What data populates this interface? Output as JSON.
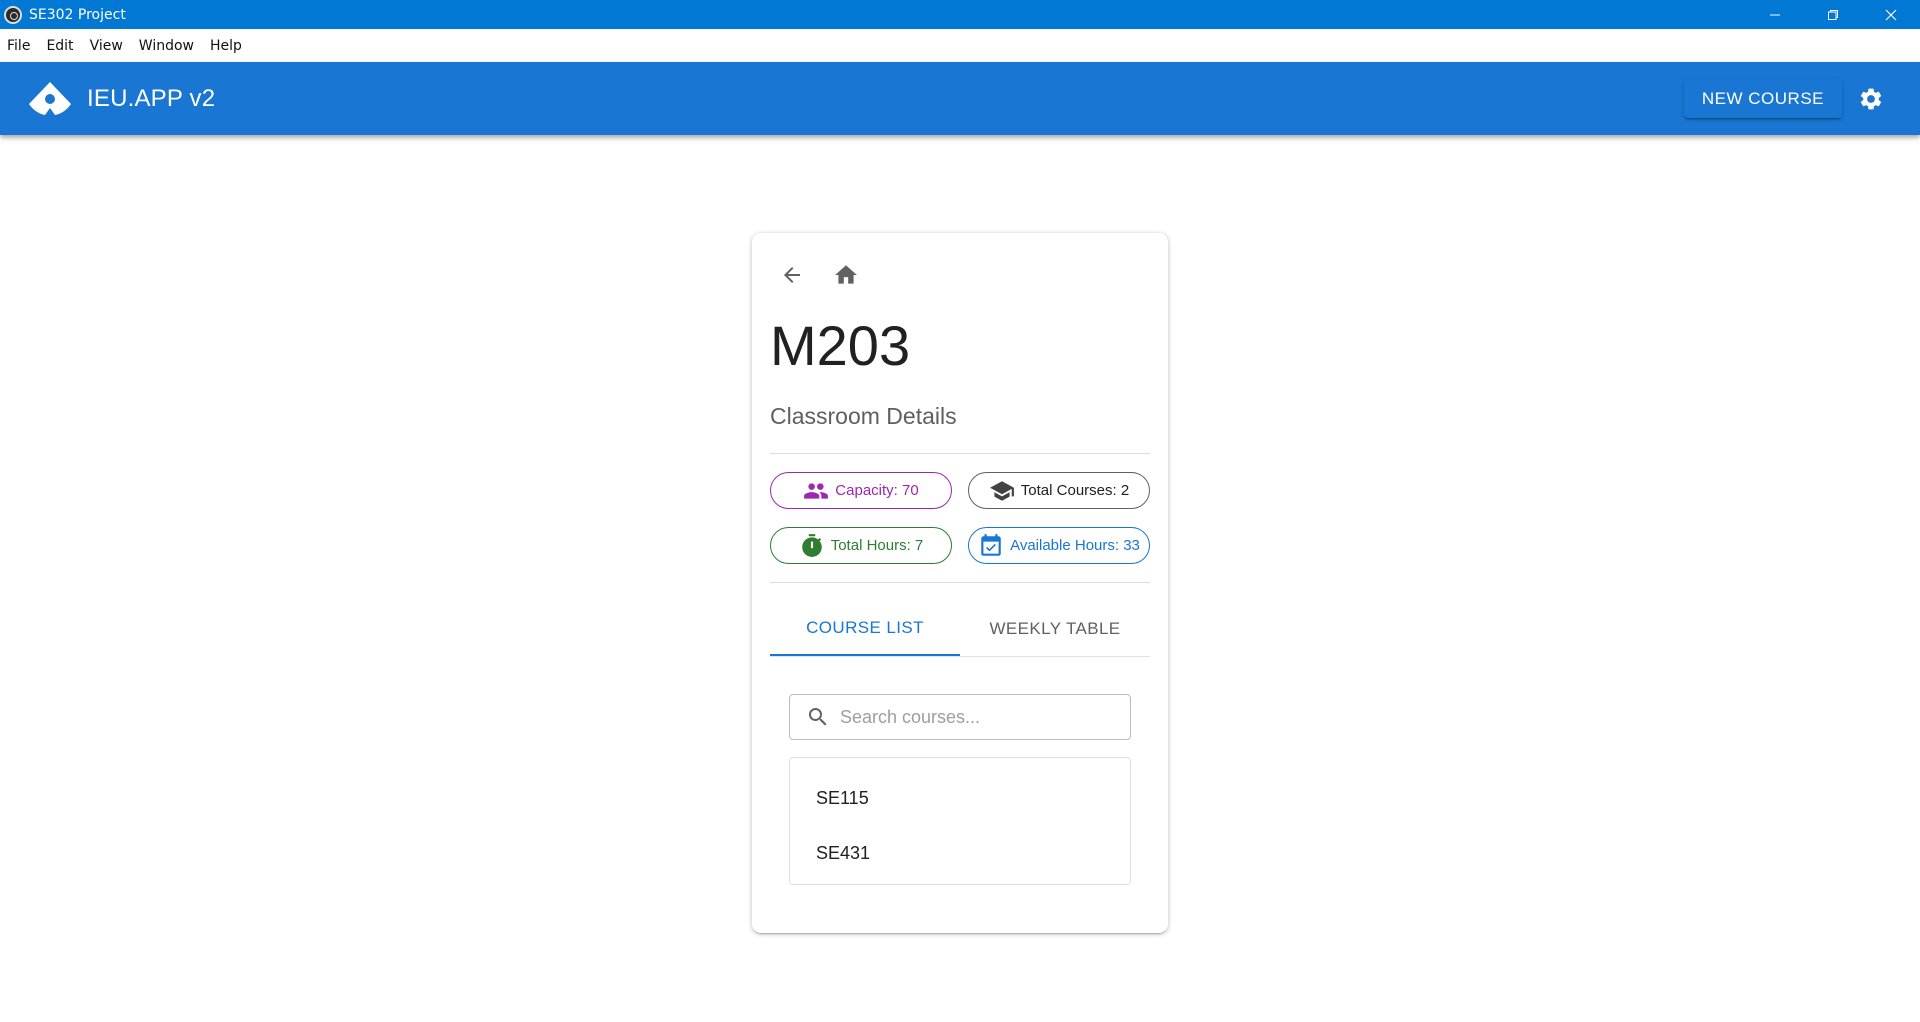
{
  "window": {
    "title": "SE302 Project",
    "menu": [
      "File",
      "Edit",
      "View",
      "Window",
      "Help"
    ]
  },
  "appbar": {
    "app_name": "IEU.APP v2",
    "new_course_label": "NEW COURSE",
    "logo_icon": "ieu-logo-icon",
    "settings_icon": "gear-icon",
    "color": "#1976d2"
  },
  "card": {
    "title": "M203",
    "subtitle": "Classroom Details",
    "chips": {
      "capacity": "Capacity: 70",
      "total_courses": "Total Courses: 2",
      "total_hours": "Total Hours: 7",
      "available_hours": "Available Hours: 33"
    },
    "chip_colors": {
      "capacity": "#9c27b0",
      "total_courses": "#616161",
      "total_hours": "#2e7d32",
      "available_hours": "#1976d2"
    },
    "tabs": [
      "COURSE LIST",
      "WEEKLY TABLE"
    ],
    "active_tab": "COURSE LIST",
    "search": {
      "placeholder": "Search courses...",
      "value": ""
    },
    "courses": [
      "SE115",
      "SE431"
    ]
  }
}
